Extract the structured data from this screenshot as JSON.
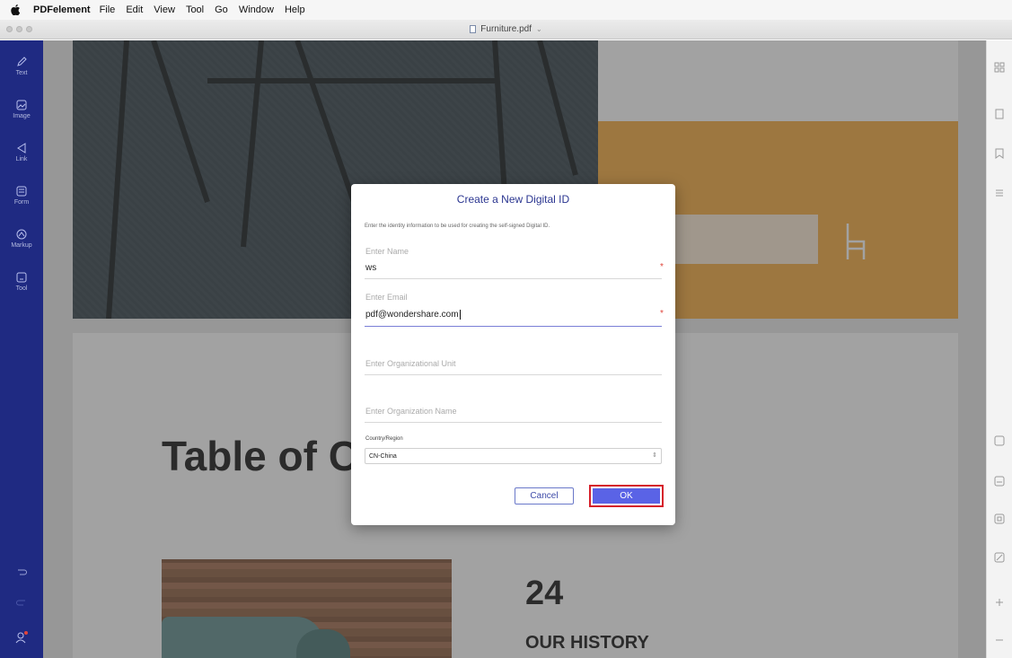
{
  "menubar": {
    "app_name": "PDFelement",
    "menus": [
      "File",
      "Edit",
      "View",
      "Tool",
      "Go",
      "Window",
      "Help"
    ]
  },
  "window": {
    "title": "Furniture.pdf",
    "title_chevron": "⌄"
  },
  "left_toolbar": {
    "items": [
      {
        "label": "Text",
        "icon": "pencil-icon"
      },
      {
        "label": "Image",
        "icon": "image-icon"
      },
      {
        "label": "Link",
        "icon": "link-icon"
      },
      {
        "label": "Form",
        "icon": "form-icon"
      },
      {
        "label": "Markup",
        "icon": "markup-icon"
      },
      {
        "label": "Tool",
        "icon": "tool-icon"
      }
    ]
  },
  "document": {
    "toc_heading": "Table of C",
    "page_number": "24",
    "section_title": "OUR HISTORY"
  },
  "dialog": {
    "title": "Create a New Digital ID",
    "description": "Enter the identity information to be used for creating the self-signed Digital ID.",
    "name_label": "Enter Name",
    "name_value": "ws",
    "email_label": "Enter Email",
    "email_value": "pdf@wondershare.com",
    "org_unit_placeholder": "Enter Organizational Unit",
    "org_name_placeholder": "Enter Organization Name",
    "country_label": "Country/Region",
    "country_value": "CN-China",
    "required_mark": "*",
    "cancel_label": "Cancel",
    "ok_label": "OK"
  },
  "colors": {
    "toolbar": "#1f2a82",
    "ok_button": "#5a63e6",
    "highlight": "#d61f2a",
    "accent_orange": "#f4a93a"
  }
}
